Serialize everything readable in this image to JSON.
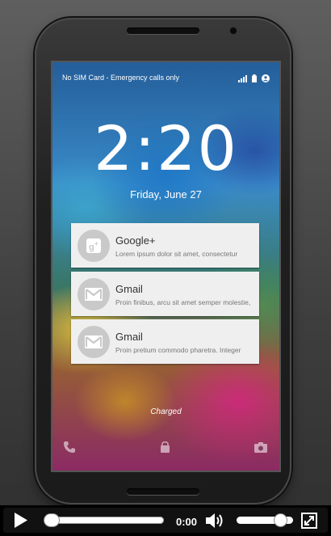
{
  "status_bar": {
    "carrier_text": "No SIM Card - Emergency calls only",
    "icons": [
      "signal-icon",
      "battery-icon",
      "account-icon"
    ]
  },
  "lockscreen": {
    "time": "2:20",
    "date": "Friday, June 27",
    "charging_text": "Charged"
  },
  "notifications": [
    {
      "app": "Google+",
      "icon": "google-plus-icon",
      "text": "Lorem ipsum dolor sit amet, consectetur"
    },
    {
      "app": "Gmail",
      "icon": "gmail-icon",
      "text": "Proin finibus, arcu sit amet semper molestie,"
    },
    {
      "app": "Gmail",
      "icon": "gmail-icon",
      "text": "Proin pretium commodo pharetra. Integer"
    }
  ],
  "bottom_shortcuts": [
    "phone-icon",
    "lock-icon",
    "camera-icon"
  ],
  "player": {
    "time_display": "0:00",
    "seek_progress": 0,
    "volume_level": 0.85
  }
}
